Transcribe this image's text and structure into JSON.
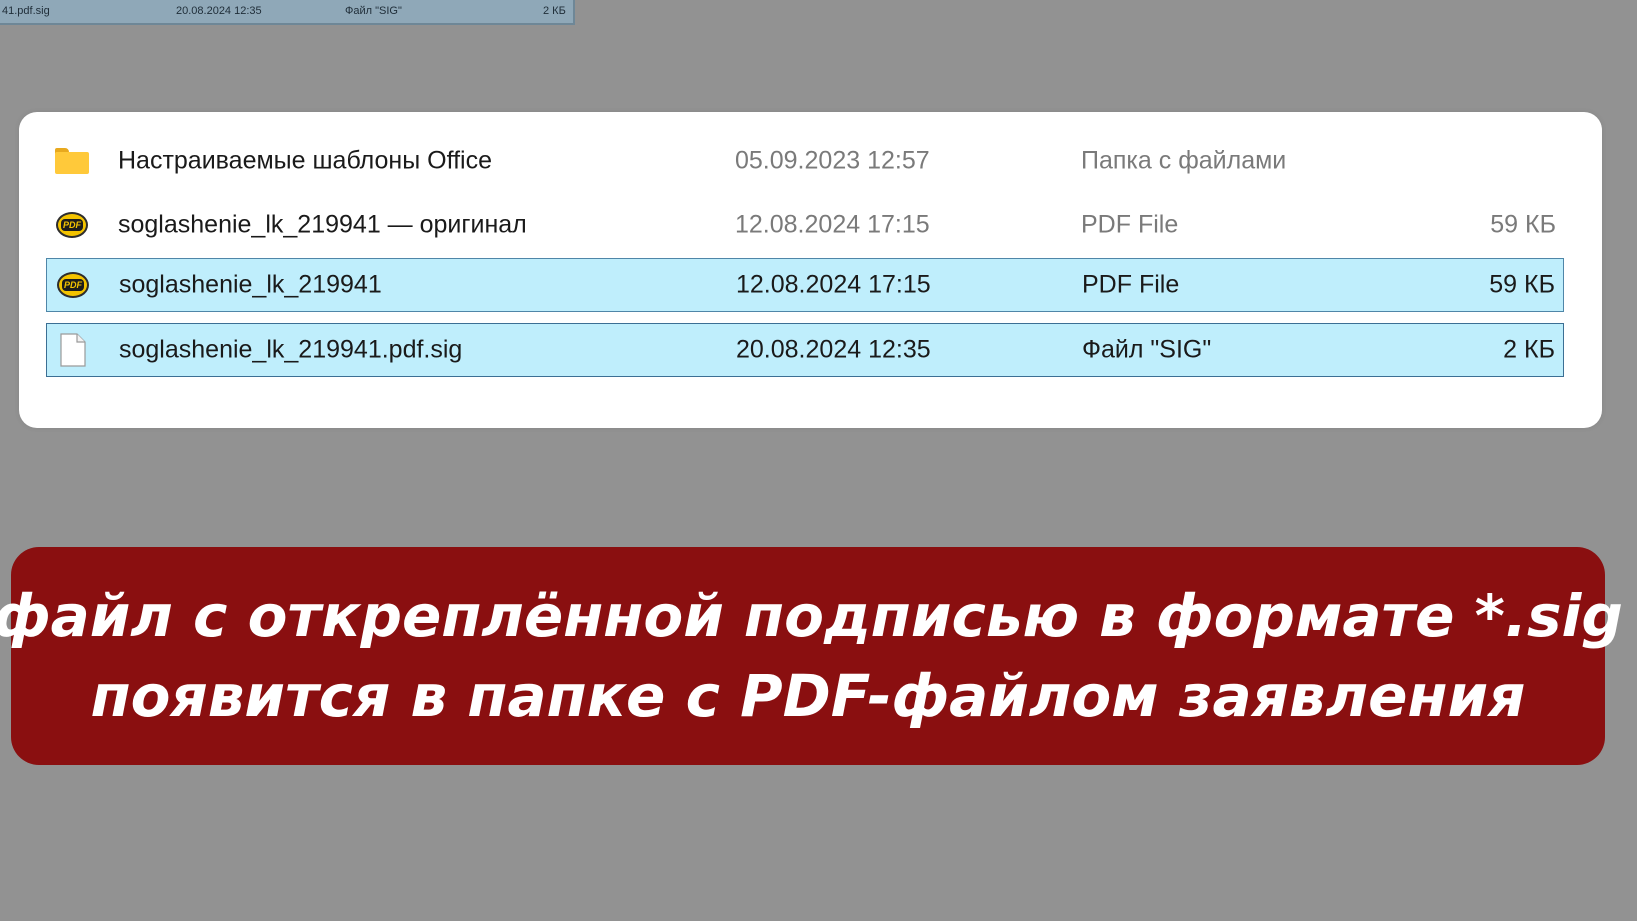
{
  "top_strip": {
    "name": "41.pdf.sig",
    "date": "20.08.2024 12:35",
    "type": "Файл \"SIG\"",
    "size": "2 КБ"
  },
  "files": [
    {
      "name": "Настраиваемые шаблоны Office",
      "date": "05.09.2023 12:57",
      "type": "Папка с файлами",
      "size": "",
      "icon": "folder-icon"
    },
    {
      "name": "soglashenie_lk_219941 — оригинал",
      "date": "12.08.2024 17:15",
      "type": "PDF File",
      "size": "59 КБ",
      "icon": "pdf-icon"
    },
    {
      "name": "soglashenie_lk_219941",
      "date": "12.08.2024 17:15",
      "type": "PDF File",
      "size": "59 КБ",
      "icon": "pdf-icon"
    },
    {
      "name": "soglashenie_lk_219941.pdf.sig",
      "date": "20.08.2024 12:35",
      "type": "Файл \"SIG\"",
      "size": "2 КБ",
      "icon": "blank-file-icon"
    }
  ],
  "caption": {
    "line1": "файл с откреплённой подписью в формате *.sig",
    "line2": "появится в папке с PDF-файлом заявления"
  },
  "colors": {
    "background": "#929292",
    "selection": "#bfeefc",
    "banner": "#8a0f10"
  }
}
